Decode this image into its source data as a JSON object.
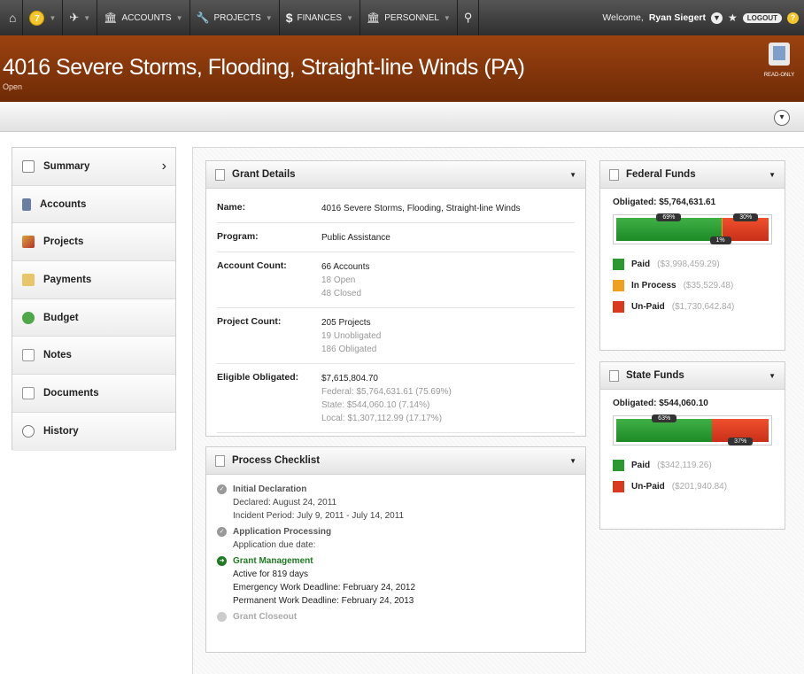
{
  "nav": {
    "notifications_count": "7",
    "accounts": "ACCOUNTS",
    "projects": "PROJECTS",
    "finances": "FINANCES",
    "personnel": "PERSONNEL",
    "welcome_prefix": "Welcome,",
    "user": "Ryan Siegert",
    "logout": "LOGOUT",
    "help": "?"
  },
  "header": {
    "title": "4016 Severe Storms, Flooding, Straight-line Winds (PA)",
    "status": "Open",
    "read_only": "READ-ONLY"
  },
  "sidebar": {
    "items": [
      {
        "label": "Summary",
        "icon": "summary-icon"
      },
      {
        "label": "Accounts",
        "icon": "accounts-icon"
      },
      {
        "label": "Projects",
        "icon": "projects-icon"
      },
      {
        "label": "Payments",
        "icon": "payments-icon"
      },
      {
        "label": "Budget",
        "icon": "budget-icon"
      },
      {
        "label": "Notes",
        "icon": "notes-icon"
      },
      {
        "label": "Documents",
        "icon": "documents-icon"
      },
      {
        "label": "History",
        "icon": "history-icon"
      }
    ]
  },
  "grant": {
    "title": "Grant Details",
    "rows": [
      {
        "key": "Name:",
        "value": "4016 Severe Storms, Flooding, Straight-line Winds",
        "subs": []
      },
      {
        "key": "Program:",
        "value": "Public Assistance",
        "subs": []
      },
      {
        "key": "Account Count:",
        "value": "66 Accounts",
        "subs": [
          "18 Open",
          "48 Closed"
        ]
      },
      {
        "key": "Project Count:",
        "value": "205 Projects",
        "subs": [
          "19 Unobligated",
          "186 Obligated"
        ]
      },
      {
        "key": "Eligible Obligated:",
        "value": "$7,615,804.70",
        "subs": [
          "Federal: $5,764,631.61 (75.69%)",
          "State: $544,060.10 (7.14%)",
          "Local: $1,307,112.99 (17.17%)"
        ]
      }
    ]
  },
  "checklist": {
    "title": "Process Checklist",
    "items": [
      {
        "title": "Initial Declaration",
        "lines": [
          "Declared: August 24, 2011",
          "Incident Period: July 9, 2011 - July 14, 2011"
        ],
        "state": "done"
      },
      {
        "title": "Application Processing",
        "lines": [
          "Application due date:"
        ],
        "state": "done"
      },
      {
        "title": "Grant Management",
        "lines": [
          "Active for 819 days",
          "Emergency Work Deadline: February 24, 2012",
          "Permanent Work Deadline: February 24, 2013"
        ],
        "state": "active"
      },
      {
        "title": "Grant Closeout",
        "lines": [],
        "state": "pending"
      }
    ]
  },
  "federal": {
    "title": "Federal Funds",
    "obligated": "Obligated: $5,764,631.61",
    "paid_pct": 69,
    "process_pct": 1,
    "unpaid_pct": 30,
    "paid_tip": "69%",
    "process_tip": "1%",
    "unpaid_tip": "30%",
    "legend": [
      {
        "label": "Paid",
        "amount": "($3,998,459.29)",
        "color": "#2a9a30"
      },
      {
        "label": "In Process",
        "amount": "($35,529.48)",
        "color": "#f0a020"
      },
      {
        "label": "Un-Paid",
        "amount": "($1,730,642.84)",
        "color": "#d8391f"
      }
    ]
  },
  "state": {
    "title": "State Funds",
    "obligated": "Obligated: $544,060.10",
    "paid_pct": 63,
    "unpaid_pct": 37,
    "paid_tip": "63%",
    "unpaid_tip": "37%",
    "legend": [
      {
        "label": "Paid",
        "amount": "($342,119.26)",
        "color": "#2a9a30"
      },
      {
        "label": "Un-Paid",
        "amount": "($201,940.84)",
        "color": "#d8391f"
      }
    ]
  }
}
